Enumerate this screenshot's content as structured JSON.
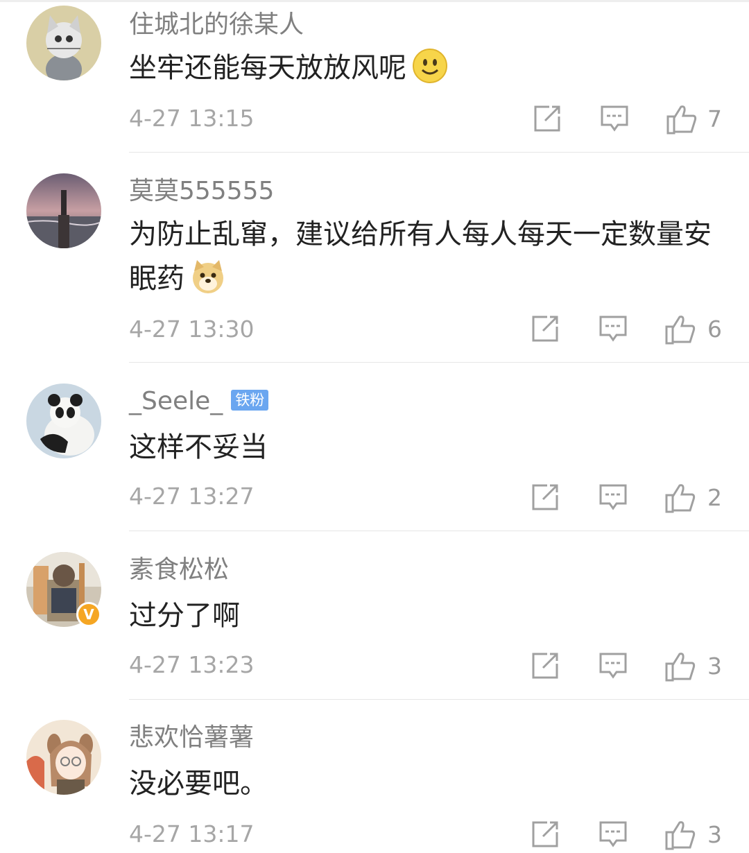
{
  "comments": [
    {
      "username": "住城北的徐某人",
      "badge": "",
      "verified": false,
      "text": "坐牢还能每天放放风呢",
      "emoji": "smile-emoji",
      "time": "4-27 13:15",
      "likes": "7"
    },
    {
      "username": "莫莫555555",
      "badge": "",
      "verified": false,
      "text": "为防止乱窜，建议给所有人每人每天一定数量安眠药",
      "emoji": "doge-emoji",
      "time": "4-27 13:30",
      "likes": "6"
    },
    {
      "username": "_Seele_",
      "badge": "铁粉",
      "verified": false,
      "text": "这样不妥当",
      "emoji": "",
      "time": "4-27 13:27",
      "likes": "2"
    },
    {
      "username": "素食松松",
      "badge": "",
      "verified": true,
      "verified_mark": "V",
      "text": "过分了啊",
      "emoji": "",
      "time": "4-27 13:23",
      "likes": "3"
    },
    {
      "username": "悲欢恰薯薯",
      "badge": "",
      "verified": false,
      "text": "没必要吧。",
      "emoji": "",
      "time": "4-27 13:17",
      "likes": "3"
    }
  ],
  "icons": {
    "share": "share-icon",
    "reply": "comment-icon",
    "like": "thumbs-up-icon"
  },
  "colors": {
    "username": "#808080",
    "text": "#222222",
    "time": "#a6a6a6",
    "badge": "#6aa6f0",
    "verified": "#f5a623"
  }
}
